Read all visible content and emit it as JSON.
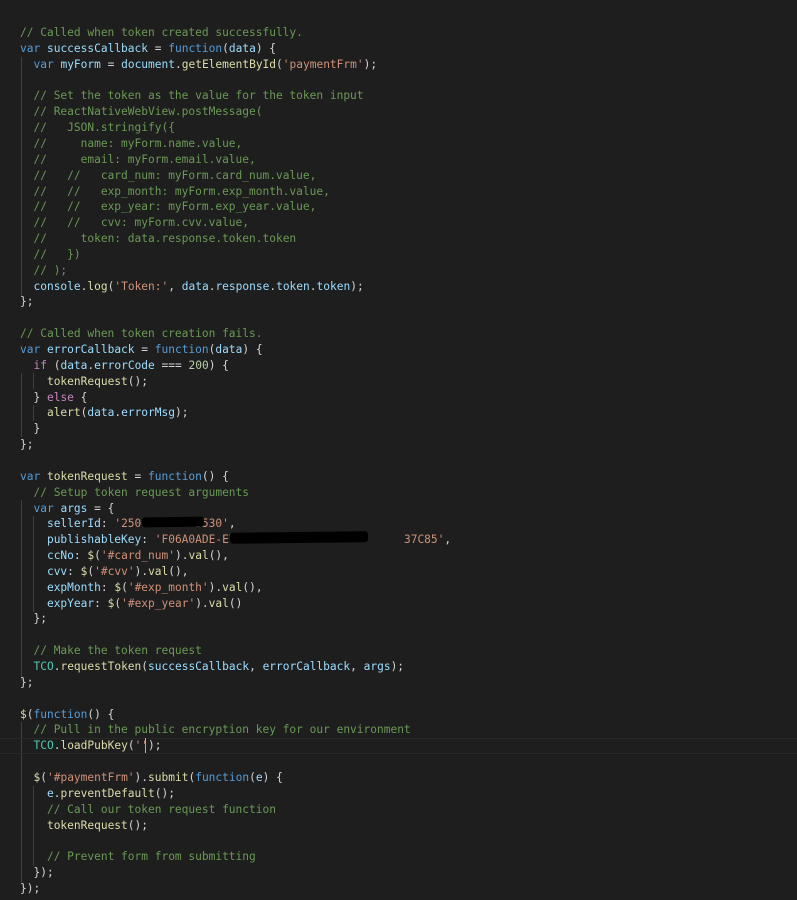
{
  "editor": {
    "language": "javascript",
    "theme_colors": {
      "background": "#1e1e1e",
      "comment": "#6a9955",
      "keyword": "#569cd6",
      "string": "#ce9178",
      "function": "#dcdcaa",
      "variable": "#9cdcfe",
      "class": "#4ec9b0",
      "number": "#b5cea8",
      "control": "#c586c0",
      "plain": "#d4d4d4",
      "indent_guide": "#404040"
    },
    "lines": [
      {
        "row": 0,
        "tokens": [
          [
            "// Called when token created successfully.",
            "comment"
          ]
        ]
      },
      {
        "row": 1,
        "tokens": [
          [
            "var",
            "keyword"
          ],
          [
            " ",
            "plain"
          ],
          [
            "successCallback",
            "variable"
          ],
          [
            " = ",
            "plain"
          ],
          [
            "function",
            "keyword"
          ],
          [
            "(",
            "plain"
          ],
          [
            "data",
            "variable"
          ],
          [
            ") {",
            "plain"
          ]
        ]
      },
      {
        "row": 2,
        "tokens": [
          [
            "  ",
            "plain"
          ],
          [
            "var",
            "keyword"
          ],
          [
            " ",
            "plain"
          ],
          [
            "myForm",
            "variable"
          ],
          [
            " = ",
            "plain"
          ],
          [
            "document",
            "variable"
          ],
          [
            ".",
            "plain"
          ],
          [
            "getElementById",
            "function"
          ],
          [
            "(",
            "plain"
          ],
          [
            "'paymentFrm'",
            "string"
          ],
          [
            ");",
            "plain"
          ]
        ]
      },
      {
        "row": 3,
        "tokens": [
          [
            "",
            "plain"
          ]
        ]
      },
      {
        "row": 4,
        "tokens": [
          [
            "  ",
            "plain"
          ],
          [
            "// Set the token as the value for the token input",
            "comment"
          ]
        ]
      },
      {
        "row": 5,
        "tokens": [
          [
            "  ",
            "plain"
          ],
          [
            "// ReactNativeWebView.postMessage(",
            "comment"
          ]
        ]
      },
      {
        "row": 6,
        "tokens": [
          [
            "  ",
            "plain"
          ],
          [
            "//   JSON.stringify({",
            "comment"
          ]
        ]
      },
      {
        "row": 7,
        "tokens": [
          [
            "  ",
            "plain"
          ],
          [
            "//     name: myForm.name.value,",
            "comment"
          ]
        ]
      },
      {
        "row": 8,
        "tokens": [
          [
            "  ",
            "plain"
          ],
          [
            "//     email: myForm.email.value,",
            "comment"
          ]
        ]
      },
      {
        "row": 9,
        "tokens": [
          [
            "  ",
            "plain"
          ],
          [
            "//   //   card_num: myForm.card_num.value,",
            "comment"
          ]
        ]
      },
      {
        "row": 10,
        "tokens": [
          [
            "  ",
            "plain"
          ],
          [
            "//   //   exp_month: myForm.exp_month.value,",
            "comment"
          ]
        ]
      },
      {
        "row": 11,
        "tokens": [
          [
            "  ",
            "plain"
          ],
          [
            "//   //   exp_year: myForm.exp_year.value,",
            "comment"
          ]
        ]
      },
      {
        "row": 12,
        "tokens": [
          [
            "  ",
            "plain"
          ],
          [
            "//   //   cvv: myForm.cvv.value,",
            "comment"
          ]
        ]
      },
      {
        "row": 13,
        "tokens": [
          [
            "  ",
            "plain"
          ],
          [
            "//     token: data.response.token.token",
            "comment"
          ]
        ]
      },
      {
        "row": 14,
        "tokens": [
          [
            "  ",
            "plain"
          ],
          [
            "//   })",
            "comment"
          ]
        ]
      },
      {
        "row": 15,
        "tokens": [
          [
            "  ",
            "plain"
          ],
          [
            "// );",
            "comment"
          ]
        ]
      },
      {
        "row": 16,
        "tokens": [
          [
            "  ",
            "plain"
          ],
          [
            "console",
            "variable"
          ],
          [
            ".",
            "plain"
          ],
          [
            "log",
            "function"
          ],
          [
            "(",
            "plain"
          ],
          [
            "'Token:'",
            "string"
          ],
          [
            ", ",
            "plain"
          ],
          [
            "data",
            "variable"
          ],
          [
            ".",
            "plain"
          ],
          [
            "response",
            "variable"
          ],
          [
            ".",
            "plain"
          ],
          [
            "token",
            "variable"
          ],
          [
            ".",
            "plain"
          ],
          [
            "token",
            "variable"
          ],
          [
            ");",
            "plain"
          ]
        ]
      },
      {
        "row": 17,
        "tokens": [
          [
            "};",
            "plain"
          ]
        ]
      },
      {
        "row": 18,
        "tokens": [
          [
            "",
            "plain"
          ]
        ]
      },
      {
        "row": 19,
        "tokens": [
          [
            "// Called when token creation fails.",
            "comment"
          ]
        ]
      },
      {
        "row": 20,
        "tokens": [
          [
            "var",
            "keyword"
          ],
          [
            " ",
            "plain"
          ],
          [
            "errorCallback",
            "variable"
          ],
          [
            " = ",
            "plain"
          ],
          [
            "function",
            "keyword"
          ],
          [
            "(",
            "plain"
          ],
          [
            "data",
            "variable"
          ],
          [
            ") {",
            "plain"
          ]
        ]
      },
      {
        "row": 21,
        "tokens": [
          [
            "  ",
            "plain"
          ],
          [
            "if",
            "control"
          ],
          [
            " (",
            "plain"
          ],
          [
            "data",
            "variable"
          ],
          [
            ".",
            "plain"
          ],
          [
            "errorCode",
            "variable"
          ],
          [
            " === ",
            "plain"
          ],
          [
            "200",
            "number"
          ],
          [
            ") {",
            "plain"
          ]
        ]
      },
      {
        "row": 22,
        "tokens": [
          [
            "    ",
            "plain"
          ],
          [
            "tokenRequest",
            "function"
          ],
          [
            "();",
            "plain"
          ]
        ]
      },
      {
        "row": 23,
        "tokens": [
          [
            "  ",
            "plain"
          ],
          [
            "} ",
            "plain"
          ],
          [
            "else",
            "control"
          ],
          [
            " {",
            "plain"
          ]
        ]
      },
      {
        "row": 24,
        "tokens": [
          [
            "    ",
            "plain"
          ],
          [
            "alert",
            "function"
          ],
          [
            "(",
            "plain"
          ],
          [
            "data",
            "variable"
          ],
          [
            ".",
            "plain"
          ],
          [
            "errorMsg",
            "variable"
          ],
          [
            ");",
            "plain"
          ]
        ]
      },
      {
        "row": 25,
        "tokens": [
          [
            "  }",
            "plain"
          ]
        ]
      },
      {
        "row": 26,
        "tokens": [
          [
            "};",
            "plain"
          ]
        ]
      },
      {
        "row": 27,
        "tokens": [
          [
            "",
            "plain"
          ]
        ]
      },
      {
        "row": 28,
        "tokens": [
          [
            "var",
            "keyword"
          ],
          [
            " ",
            "plain"
          ],
          [
            "tokenRequest",
            "function"
          ],
          [
            " = ",
            "plain"
          ],
          [
            "function",
            "keyword"
          ],
          [
            "() {",
            "plain"
          ]
        ]
      },
      {
        "row": 29,
        "tokens": [
          [
            "  ",
            "plain"
          ],
          [
            "// Setup token request arguments",
            "comment"
          ]
        ]
      },
      {
        "row": 30,
        "tokens": [
          [
            "  ",
            "plain"
          ],
          [
            "var",
            "keyword"
          ],
          [
            " ",
            "plain"
          ],
          [
            "args",
            "variable"
          ],
          [
            " = {",
            "plain"
          ]
        ]
      },
      {
        "row": 31,
        "tokens": [
          [
            "    ",
            "plain"
          ],
          [
            "sellerId",
            "variable"
          ],
          [
            ": ",
            "plain"
          ],
          [
            "'250",
            "string"
          ],
          [
            "        ",
            "plain"
          ],
          [
            "5530'",
            "string"
          ],
          [
            ",",
            "plain"
          ]
        ]
      },
      {
        "row": 32,
        "tokens": [
          [
            "    ",
            "plain"
          ],
          [
            "publishableKey",
            "variable"
          ],
          [
            ": ",
            "plain"
          ],
          [
            "'F06A0ADE-E75A-4DD0",
            "string"
          ],
          [
            "                  ",
            "plain"
          ],
          [
            "37C85'",
            "string"
          ],
          [
            ",",
            "plain"
          ]
        ]
      },
      {
        "row": 33,
        "tokens": [
          [
            "    ",
            "plain"
          ],
          [
            "ccNo",
            "variable"
          ],
          [
            ": ",
            "plain"
          ],
          [
            "$",
            "function"
          ],
          [
            "(",
            "plain"
          ],
          [
            "'#card_num'",
            "string"
          ],
          [
            ").",
            "plain"
          ],
          [
            "val",
            "function"
          ],
          [
            "(),",
            "plain"
          ]
        ]
      },
      {
        "row": 34,
        "tokens": [
          [
            "    ",
            "plain"
          ],
          [
            "cvv",
            "variable"
          ],
          [
            ": ",
            "plain"
          ],
          [
            "$",
            "function"
          ],
          [
            "(",
            "plain"
          ],
          [
            "'#cvv'",
            "string"
          ],
          [
            ").",
            "plain"
          ],
          [
            "val",
            "function"
          ],
          [
            "(),",
            "plain"
          ]
        ]
      },
      {
        "row": 35,
        "tokens": [
          [
            "    ",
            "plain"
          ],
          [
            "expMonth",
            "variable"
          ],
          [
            ": ",
            "plain"
          ],
          [
            "$",
            "function"
          ],
          [
            "(",
            "plain"
          ],
          [
            "'#exp_month'",
            "string"
          ],
          [
            ").",
            "plain"
          ],
          [
            "val",
            "function"
          ],
          [
            "(),",
            "plain"
          ]
        ]
      },
      {
        "row": 36,
        "tokens": [
          [
            "    ",
            "plain"
          ],
          [
            "expYear",
            "variable"
          ],
          [
            ": ",
            "plain"
          ],
          [
            "$",
            "function"
          ],
          [
            "(",
            "plain"
          ],
          [
            "'#exp_year'",
            "string"
          ],
          [
            ").",
            "plain"
          ],
          [
            "val",
            "function"
          ],
          [
            "()",
            "plain"
          ]
        ]
      },
      {
        "row": 37,
        "tokens": [
          [
            "  };",
            "plain"
          ]
        ]
      },
      {
        "row": 38,
        "tokens": [
          [
            "",
            "plain"
          ]
        ]
      },
      {
        "row": 39,
        "tokens": [
          [
            "  ",
            "plain"
          ],
          [
            "// Make the token request",
            "comment"
          ]
        ]
      },
      {
        "row": 40,
        "tokens": [
          [
            "  ",
            "plain"
          ],
          [
            "TCO",
            "class"
          ],
          [
            ".",
            "plain"
          ],
          [
            "requestToken",
            "function"
          ],
          [
            "(",
            "plain"
          ],
          [
            "successCallback",
            "variable"
          ],
          [
            ", ",
            "plain"
          ],
          [
            "errorCallback",
            "variable"
          ],
          [
            ", ",
            "plain"
          ],
          [
            "args",
            "variable"
          ],
          [
            ");",
            "plain"
          ]
        ]
      },
      {
        "row": 41,
        "tokens": [
          [
            "};",
            "plain"
          ]
        ]
      },
      {
        "row": 42,
        "tokens": [
          [
            "",
            "plain"
          ]
        ]
      },
      {
        "row": 43,
        "tokens": [
          [
            "$",
            "function"
          ],
          [
            "(",
            "plain"
          ],
          [
            "function",
            "keyword"
          ],
          [
            "() {",
            "plain"
          ]
        ]
      },
      {
        "row": 44,
        "tokens": [
          [
            "  ",
            "plain"
          ],
          [
            "// Pull in the public encryption key for our environment",
            "comment"
          ]
        ]
      },
      {
        "row": 45,
        "tokens": [
          [
            "  ",
            "plain"
          ],
          [
            "TCO",
            "class"
          ],
          [
            ".",
            "plain"
          ],
          [
            "loadPubKey",
            "function"
          ],
          [
            "(",
            "plain"
          ],
          [
            "''",
            "string"
          ],
          [
            ");",
            "plain"
          ]
        ]
      },
      {
        "row": 46,
        "tokens": [
          [
            "",
            "plain"
          ]
        ]
      },
      {
        "row": 47,
        "tokens": [
          [
            "  ",
            "plain"
          ],
          [
            "$",
            "function"
          ],
          [
            "(",
            "plain"
          ],
          [
            "'#paymentFrm'",
            "string"
          ],
          [
            ").",
            "plain"
          ],
          [
            "submit",
            "function"
          ],
          [
            "(",
            "plain"
          ],
          [
            "function",
            "keyword"
          ],
          [
            "(",
            "plain"
          ],
          [
            "e",
            "variable"
          ],
          [
            ") {",
            "plain"
          ]
        ]
      },
      {
        "row": 48,
        "tokens": [
          [
            "    ",
            "plain"
          ],
          [
            "e",
            "variable"
          ],
          [
            ".",
            "plain"
          ],
          [
            "preventDefault",
            "function"
          ],
          [
            "();",
            "plain"
          ]
        ]
      },
      {
        "row": 49,
        "tokens": [
          [
            "    ",
            "plain"
          ],
          [
            "// Call our token request function",
            "comment"
          ]
        ]
      },
      {
        "row": 50,
        "tokens": [
          [
            "    ",
            "plain"
          ],
          [
            "tokenRequest",
            "function"
          ],
          [
            "();",
            "plain"
          ]
        ]
      },
      {
        "row": 51,
        "tokens": [
          [
            "",
            "plain"
          ]
        ]
      },
      {
        "row": 52,
        "tokens": [
          [
            "    ",
            "plain"
          ],
          [
            "// Prevent form from submitting",
            "comment"
          ]
        ]
      },
      {
        "row": 53,
        "tokens": [
          [
            "  });",
            "plain"
          ]
        ]
      },
      {
        "row": 54,
        "tokens": [
          [
            "});",
            "plain"
          ]
        ]
      }
    ],
    "current_line_row": 45
  }
}
